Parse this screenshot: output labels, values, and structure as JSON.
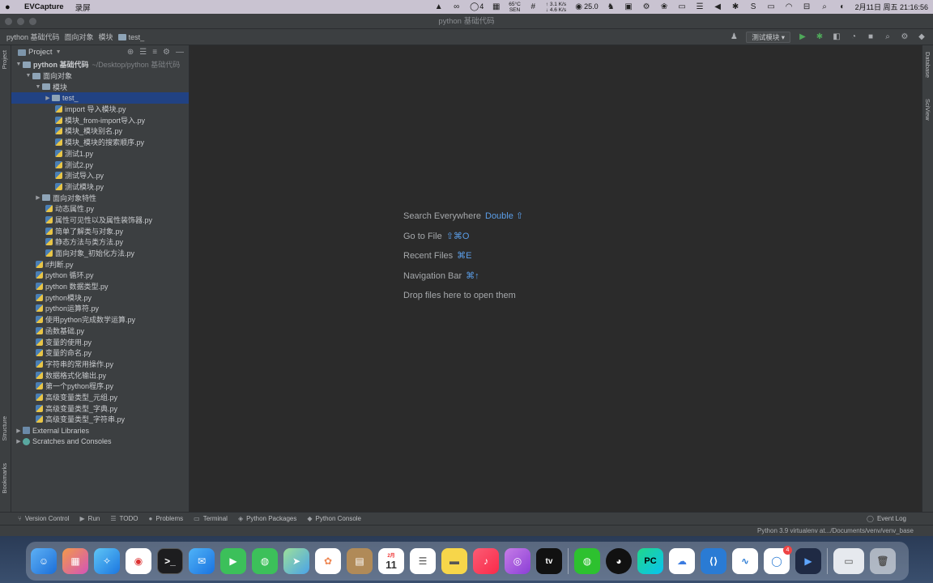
{
  "menubar": {
    "app_name": "EVCapture",
    "menu_item": "录屏",
    "qq_count": "4",
    "cpu_temp": "65°C",
    "cpu_label": "SEN",
    "net_up": "↑ 3.1 K/s",
    "net_down": "↓ 4.6 K/s",
    "fps": "25.0",
    "datetime": "2月11日 周五 21:16:56"
  },
  "window": {
    "title": "python 基础代码"
  },
  "navbar": {
    "crumbs": [
      "python 基础代码",
      "面向对象",
      "模块",
      "test_"
    ],
    "run_config": "测试模块"
  },
  "project_panel": {
    "title": "Project",
    "root_name": "python 基础代码",
    "root_path": "~/Desktop/python 基础代码",
    "items": [
      {
        "label": "面向对象"
      },
      {
        "label": "模块"
      },
      {
        "label": "test_"
      },
      {
        "label": "import 导入模块.py"
      },
      {
        "label": "模块_from-import导入.py"
      },
      {
        "label": "模块_模块别名.py"
      },
      {
        "label": "模块_模块的搜索顺序.py"
      },
      {
        "label": "测试1.py"
      },
      {
        "label": "测试2.py"
      },
      {
        "label": "测试导入.py"
      },
      {
        "label": "测试模块.py"
      },
      {
        "label": "面向对象特性"
      },
      {
        "label": "动态属性.py"
      },
      {
        "label": "属性可见性以及属性装饰器.py"
      },
      {
        "label": "简单了解类与对象.py"
      },
      {
        "label": "静态方法与类方法.py"
      },
      {
        "label": "面向对象_初始化方法.py"
      },
      {
        "label": "if判断.py"
      },
      {
        "label": "python 循环.py"
      },
      {
        "label": "python 数据类型.py"
      },
      {
        "label": "python模块.py"
      },
      {
        "label": "python运算符.py"
      },
      {
        "label": "使用python完成数学运算.py"
      },
      {
        "label": "函数基础.py"
      },
      {
        "label": "变量的使用.py"
      },
      {
        "label": "变量的命名.py"
      },
      {
        "label": "字符串的常用操作.py"
      },
      {
        "label": "数据格式化输出.py"
      },
      {
        "label": "第一个python程序.py"
      },
      {
        "label": "高级变量类型_元组.py"
      },
      {
        "label": "高级变量类型_字典.py"
      },
      {
        "label": "高级变量类型_字符串.py"
      },
      {
        "label": "External Libraries"
      },
      {
        "label": "Scratches and Consoles"
      }
    ]
  },
  "welcome": {
    "lines": [
      {
        "label": "Search Everywhere",
        "key": "Double ⇧"
      },
      {
        "label": "Go to File",
        "key": "⇧⌘O"
      },
      {
        "label": "Recent Files",
        "key": "⌘E"
      },
      {
        "label": "Navigation Bar",
        "key": "⌘↑"
      },
      {
        "label": "Drop files here to open them",
        "key": ""
      }
    ]
  },
  "left_strip": {
    "project": "Project",
    "structure": "Structure",
    "bookmarks": "Bookmarks"
  },
  "right_strip": {
    "database": "Database",
    "sciview": "SciView"
  },
  "bottom_tabs": {
    "version_control": "Version Control",
    "run": "Run",
    "todo": "TODO",
    "problems": "Problems",
    "terminal": "Terminal",
    "python_packages": "Python Packages",
    "python_console": "Python Console",
    "event_log": "Event Log"
  },
  "statusbar": {
    "interpreter": "Python 3.9 virtualenv at.../Documents/venv/venv_base"
  },
  "dock": {
    "calendar_month": "2月",
    "calendar_day": "11",
    "tv_label": "tv",
    "pycharm_label": "PC",
    "qq_badge": "4"
  }
}
